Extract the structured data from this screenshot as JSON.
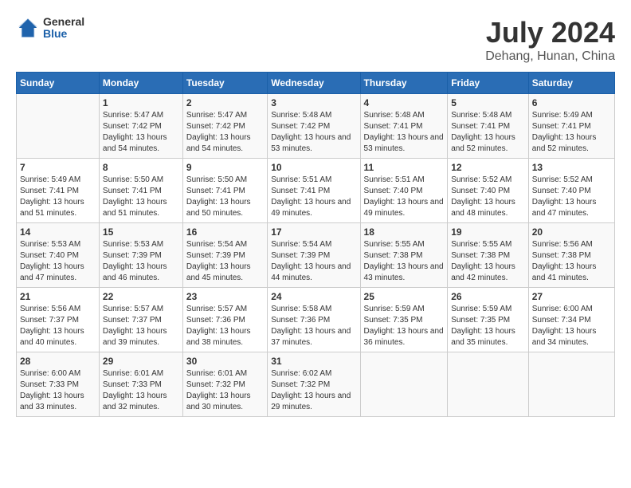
{
  "header": {
    "logo": {
      "general": "General",
      "blue": "Blue"
    },
    "title": "July 2024",
    "location": "Dehang, Hunan, China"
  },
  "columns": [
    "Sunday",
    "Monday",
    "Tuesday",
    "Wednesday",
    "Thursday",
    "Friday",
    "Saturday"
  ],
  "weeks": [
    [
      {
        "day": "",
        "sunrise": "",
        "sunset": "",
        "daylight": ""
      },
      {
        "day": "1",
        "sunrise": "Sunrise: 5:47 AM",
        "sunset": "Sunset: 7:42 PM",
        "daylight": "Daylight: 13 hours and 54 minutes."
      },
      {
        "day": "2",
        "sunrise": "Sunrise: 5:47 AM",
        "sunset": "Sunset: 7:42 PM",
        "daylight": "Daylight: 13 hours and 54 minutes."
      },
      {
        "day": "3",
        "sunrise": "Sunrise: 5:48 AM",
        "sunset": "Sunset: 7:42 PM",
        "daylight": "Daylight: 13 hours and 53 minutes."
      },
      {
        "day": "4",
        "sunrise": "Sunrise: 5:48 AM",
        "sunset": "Sunset: 7:41 PM",
        "daylight": "Daylight: 13 hours and 53 minutes."
      },
      {
        "day": "5",
        "sunrise": "Sunrise: 5:48 AM",
        "sunset": "Sunset: 7:41 PM",
        "daylight": "Daylight: 13 hours and 52 minutes."
      },
      {
        "day": "6",
        "sunrise": "Sunrise: 5:49 AM",
        "sunset": "Sunset: 7:41 PM",
        "daylight": "Daylight: 13 hours and 52 minutes."
      }
    ],
    [
      {
        "day": "7",
        "sunrise": "Sunrise: 5:49 AM",
        "sunset": "Sunset: 7:41 PM",
        "daylight": "Daylight: 13 hours and 51 minutes."
      },
      {
        "day": "8",
        "sunrise": "Sunrise: 5:50 AM",
        "sunset": "Sunset: 7:41 PM",
        "daylight": "Daylight: 13 hours and 51 minutes."
      },
      {
        "day": "9",
        "sunrise": "Sunrise: 5:50 AM",
        "sunset": "Sunset: 7:41 PM",
        "daylight": "Daylight: 13 hours and 50 minutes."
      },
      {
        "day": "10",
        "sunrise": "Sunrise: 5:51 AM",
        "sunset": "Sunset: 7:41 PM",
        "daylight": "Daylight: 13 hours and 49 minutes."
      },
      {
        "day": "11",
        "sunrise": "Sunrise: 5:51 AM",
        "sunset": "Sunset: 7:40 PM",
        "daylight": "Daylight: 13 hours and 49 minutes."
      },
      {
        "day": "12",
        "sunrise": "Sunrise: 5:52 AM",
        "sunset": "Sunset: 7:40 PM",
        "daylight": "Daylight: 13 hours and 48 minutes."
      },
      {
        "day": "13",
        "sunrise": "Sunrise: 5:52 AM",
        "sunset": "Sunset: 7:40 PM",
        "daylight": "Daylight: 13 hours and 47 minutes."
      }
    ],
    [
      {
        "day": "14",
        "sunrise": "Sunrise: 5:53 AM",
        "sunset": "Sunset: 7:40 PM",
        "daylight": "Daylight: 13 hours and 47 minutes."
      },
      {
        "day": "15",
        "sunrise": "Sunrise: 5:53 AM",
        "sunset": "Sunset: 7:39 PM",
        "daylight": "Daylight: 13 hours and 46 minutes."
      },
      {
        "day": "16",
        "sunrise": "Sunrise: 5:54 AM",
        "sunset": "Sunset: 7:39 PM",
        "daylight": "Daylight: 13 hours and 45 minutes."
      },
      {
        "day": "17",
        "sunrise": "Sunrise: 5:54 AM",
        "sunset": "Sunset: 7:39 PM",
        "daylight": "Daylight: 13 hours and 44 minutes."
      },
      {
        "day": "18",
        "sunrise": "Sunrise: 5:55 AM",
        "sunset": "Sunset: 7:38 PM",
        "daylight": "Daylight: 13 hours and 43 minutes."
      },
      {
        "day": "19",
        "sunrise": "Sunrise: 5:55 AM",
        "sunset": "Sunset: 7:38 PM",
        "daylight": "Daylight: 13 hours and 42 minutes."
      },
      {
        "day": "20",
        "sunrise": "Sunrise: 5:56 AM",
        "sunset": "Sunset: 7:38 PM",
        "daylight": "Daylight: 13 hours and 41 minutes."
      }
    ],
    [
      {
        "day": "21",
        "sunrise": "Sunrise: 5:56 AM",
        "sunset": "Sunset: 7:37 PM",
        "daylight": "Daylight: 13 hours and 40 minutes."
      },
      {
        "day": "22",
        "sunrise": "Sunrise: 5:57 AM",
        "sunset": "Sunset: 7:37 PM",
        "daylight": "Daylight: 13 hours and 39 minutes."
      },
      {
        "day": "23",
        "sunrise": "Sunrise: 5:57 AM",
        "sunset": "Sunset: 7:36 PM",
        "daylight": "Daylight: 13 hours and 38 minutes."
      },
      {
        "day": "24",
        "sunrise": "Sunrise: 5:58 AM",
        "sunset": "Sunset: 7:36 PM",
        "daylight": "Daylight: 13 hours and 37 minutes."
      },
      {
        "day": "25",
        "sunrise": "Sunrise: 5:59 AM",
        "sunset": "Sunset: 7:35 PM",
        "daylight": "Daylight: 13 hours and 36 minutes."
      },
      {
        "day": "26",
        "sunrise": "Sunrise: 5:59 AM",
        "sunset": "Sunset: 7:35 PM",
        "daylight": "Daylight: 13 hours and 35 minutes."
      },
      {
        "day": "27",
        "sunrise": "Sunrise: 6:00 AM",
        "sunset": "Sunset: 7:34 PM",
        "daylight": "Daylight: 13 hours and 34 minutes."
      }
    ],
    [
      {
        "day": "28",
        "sunrise": "Sunrise: 6:00 AM",
        "sunset": "Sunset: 7:33 PM",
        "daylight": "Daylight: 13 hours and 33 minutes."
      },
      {
        "day": "29",
        "sunrise": "Sunrise: 6:01 AM",
        "sunset": "Sunset: 7:33 PM",
        "daylight": "Daylight: 13 hours and 32 minutes."
      },
      {
        "day": "30",
        "sunrise": "Sunrise: 6:01 AM",
        "sunset": "Sunset: 7:32 PM",
        "daylight": "Daylight: 13 hours and 30 minutes."
      },
      {
        "day": "31",
        "sunrise": "Sunrise: 6:02 AM",
        "sunset": "Sunset: 7:32 PM",
        "daylight": "Daylight: 13 hours and 29 minutes."
      },
      {
        "day": "",
        "sunrise": "",
        "sunset": "",
        "daylight": ""
      },
      {
        "day": "",
        "sunrise": "",
        "sunset": "",
        "daylight": ""
      },
      {
        "day": "",
        "sunrise": "",
        "sunset": "",
        "daylight": ""
      }
    ]
  ]
}
